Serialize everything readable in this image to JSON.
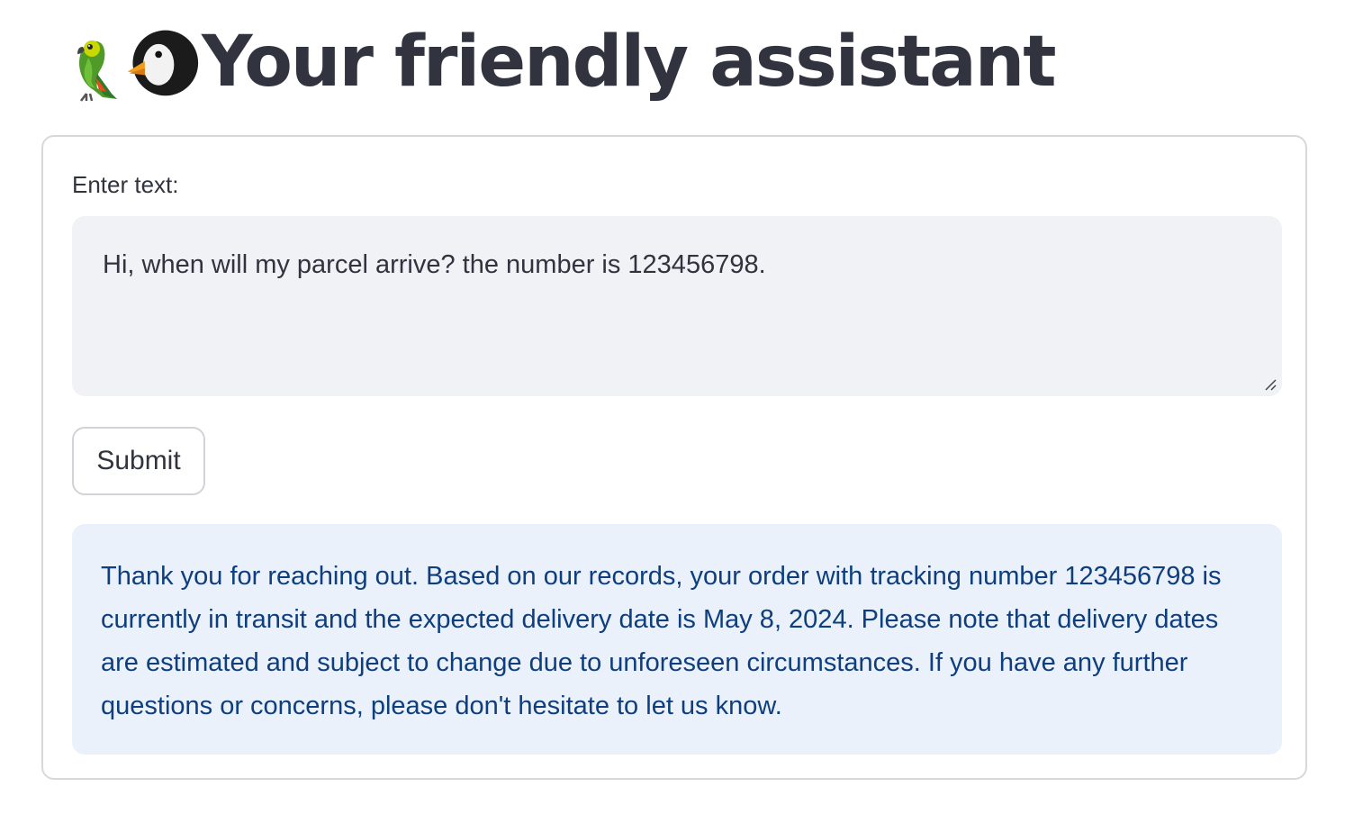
{
  "header": {
    "title": "Your friendly assistant",
    "emojis": [
      "parrot-emoji",
      "penguin-emoji"
    ]
  },
  "form": {
    "input_label": "Enter text:",
    "input_value": "Hi, when will my parcel arrive? the number is 123456798.",
    "submit_label": "Submit"
  },
  "response": {
    "text": "Thank you for reaching out. Based on our records, your order with tracking number 123456798 is currently in transit and the expected delivery date is May 8, 2024. Please note that delivery dates are estimated and subject to change due to unforeseen circumstances. If you have any further questions or concerns, please don't hesitate to let us know."
  },
  "colors": {
    "title": "#31333f",
    "input_bg": "#f0f2f6",
    "response_bg": "#eaf1fb",
    "response_text": "#0e3e7d",
    "border": "#d8d8dc"
  }
}
